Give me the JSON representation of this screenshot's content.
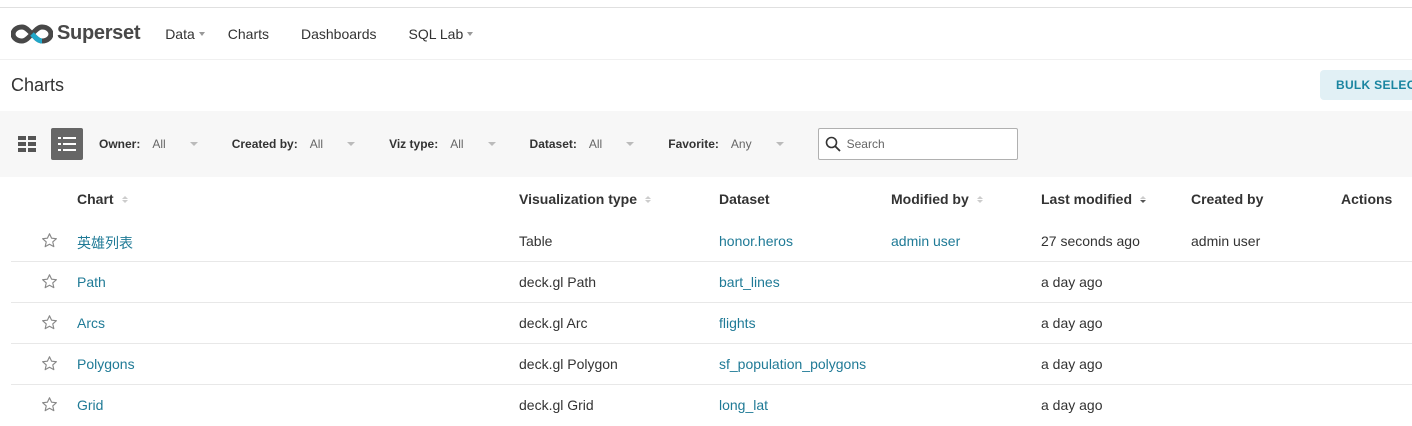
{
  "navbar": {
    "brand": "Superset",
    "items": [
      {
        "label": "Data",
        "dropdown": true
      },
      {
        "label": "Charts",
        "dropdown": false
      },
      {
        "label": "Dashboards",
        "dropdown": false
      },
      {
        "label": "SQL Lab",
        "dropdown": true
      }
    ]
  },
  "page": {
    "title": "Charts",
    "bulk_select_label": "BULK SELECT"
  },
  "filters": {
    "owner": {
      "label": "Owner:",
      "value": "All"
    },
    "created_by": {
      "label": "Created by:",
      "value": "All"
    },
    "viz_type": {
      "label": "Viz type:",
      "value": "All"
    },
    "dataset": {
      "label": "Dataset:",
      "value": "All"
    },
    "favorite": {
      "label": "Favorite:",
      "value": "Any"
    },
    "search_placeholder": "Search"
  },
  "table": {
    "columns": {
      "chart": "Chart",
      "viz_type": "Visualization type",
      "dataset": "Dataset",
      "modified_by": "Modified by",
      "last_modified": "Last modified",
      "created_by": "Created by",
      "actions": "Actions"
    },
    "rows": [
      {
        "chart": "英雄列表",
        "viz_type": "Table",
        "dataset": "honor.heros",
        "modified_by": "admin user",
        "last_modified": "27 seconds ago",
        "created_by": "admin user"
      },
      {
        "chart": "Path",
        "viz_type": "deck.gl Path",
        "dataset": "bart_lines",
        "modified_by": "",
        "last_modified": "a day ago",
        "created_by": ""
      },
      {
        "chart": "Arcs",
        "viz_type": "deck.gl Arc",
        "dataset": "flights",
        "modified_by": "",
        "last_modified": "a day ago",
        "created_by": ""
      },
      {
        "chart": "Polygons",
        "viz_type": "deck.gl Polygon",
        "dataset": "sf_population_polygons",
        "modified_by": "",
        "last_modified": "a day ago",
        "created_by": ""
      },
      {
        "chart": "Grid",
        "viz_type": "deck.gl Grid",
        "dataset": "long_lat",
        "modified_by": "",
        "last_modified": "a day ago",
        "created_by": ""
      }
    ]
  },
  "colors": {
    "link": "#1f7a96",
    "accent_bg": "#e1f0f5",
    "accent_text": "#1a85a0"
  }
}
